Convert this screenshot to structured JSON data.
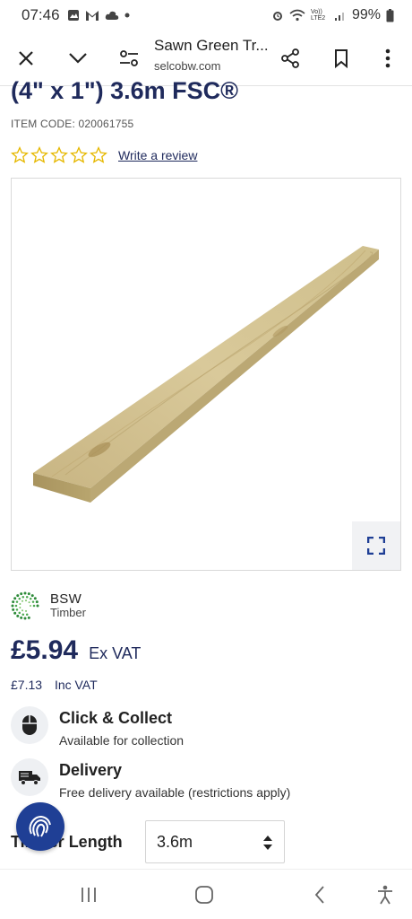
{
  "status_bar": {
    "time": "07:46",
    "battery": "99%",
    "network": "Vo)) LTE2"
  },
  "browser": {
    "title": "Sawn Green Tr...",
    "domain": "selcobw.com",
    "icons": [
      "close-icon",
      "chevron-down-icon",
      "page-settings-icon",
      "share-icon",
      "bookmark-icon",
      "more-icon"
    ]
  },
  "product": {
    "title_partial": "(4\" x 1\") 3.6m FSC®",
    "item_code": "ITEM CODE: 020061755",
    "rating": 0,
    "rating_max": 5,
    "review_link": "Write a review",
    "brand_name": "BSW",
    "brand_sub": "Timber",
    "price_ex": "£5.94",
    "price_ex_label": "Ex VAT",
    "price_inc": "£7.13",
    "price_inc_label": "Inc VAT"
  },
  "fulfilment": {
    "collect_title": "Click & Collect",
    "collect_sub": "Available for collection",
    "delivery_title": "Delivery",
    "delivery_sub": "Free delivery available (restrictions apply)"
  },
  "length": {
    "label": "Timber Length",
    "selected": "3.6m"
  },
  "colors": {
    "brand_navy": "#1f2a5c",
    "star_yellow": "#e6b800",
    "fab_blue": "#1f3f95"
  }
}
